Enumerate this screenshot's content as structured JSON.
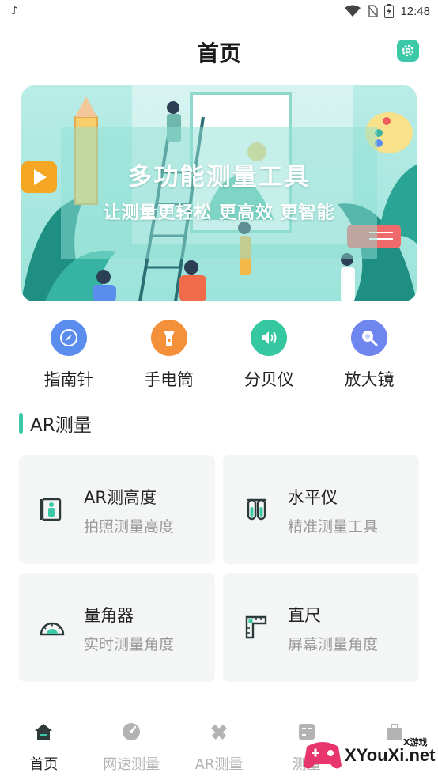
{
  "status_bar": {
    "time": "12:48"
  },
  "header": {
    "title": "首页"
  },
  "banner": {
    "title": "多功能测量工具",
    "subtitle": "让测量更轻松  更高效  更智能"
  },
  "tools": [
    {
      "label": "指南针",
      "icon": "compass-icon",
      "color": "#5b8def"
    },
    {
      "label": "手电筒",
      "icon": "flashlight-icon",
      "color": "#f5903a"
    },
    {
      "label": "分贝仪",
      "icon": "speaker-icon",
      "color": "#35c7a0"
    },
    {
      "label": "放大镜",
      "icon": "magnifier-icon",
      "color": "#6f86f0"
    }
  ],
  "section": {
    "title": "AR测量"
  },
  "cards": [
    {
      "title": "AR测高度",
      "subtitle": "拍照测量高度",
      "icon": "height-icon"
    },
    {
      "title": "水平仪",
      "subtitle": "精准测量工具",
      "icon": "level-icon"
    },
    {
      "title": "量角器",
      "subtitle": "实时测量角度",
      "icon": "protractor-icon"
    },
    {
      "title": "直尺",
      "subtitle": "屏幕测量角度",
      "icon": "ruler-icon"
    }
  ],
  "bottom_nav": [
    {
      "label": "首页",
      "icon": "home-icon",
      "active": true
    },
    {
      "label": "网速测量",
      "icon": "speedometer-icon",
      "active": false
    },
    {
      "label": "AR测量",
      "icon": "pencil-ruler-icon",
      "active": false
    },
    {
      "label": "测量",
      "icon": "calculator-icon",
      "active": false
    },
    {
      "label": "",
      "icon": "toolbox-icon",
      "active": false
    }
  ],
  "watermark": {
    "text": "XYouXi.net",
    "small": "X游戏"
  },
  "colors": {
    "accent": "#3cc9a8",
    "inactive": "#b3b3b3",
    "card_bg": "#f4f5f5"
  }
}
